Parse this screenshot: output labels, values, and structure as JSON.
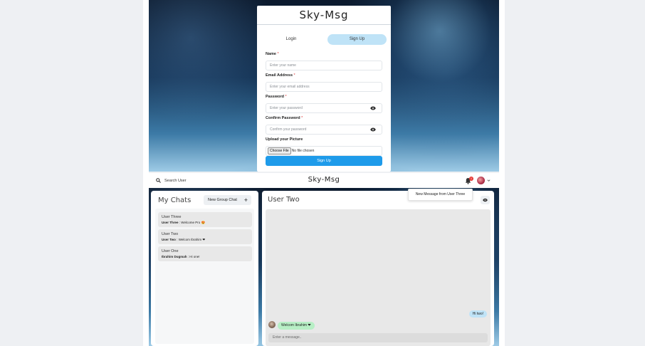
{
  "signup": {
    "title": "Sky-Msg",
    "tabs": {
      "login": "Login",
      "signup": "Sign Up"
    },
    "name": {
      "label": "Name",
      "required": "*",
      "placeholder": "Enter your name"
    },
    "email": {
      "label": "Email Address",
      "required": "*",
      "placeholder": "Enter your email address"
    },
    "password": {
      "label": "Password",
      "required": "*",
      "placeholder": "Enter your password"
    },
    "confirm": {
      "label": "Confirm Password",
      "required": "*",
      "placeholder": "Confirm your password"
    },
    "picture": {
      "label": "Upload your Picture",
      "choose_label": "Choose File",
      "no_file": "No file chosen"
    },
    "submit_label": "Sign Up"
  },
  "header": {
    "search_label": "Search User",
    "title": "Sky-Msg",
    "notification_count": "1"
  },
  "notification_popup": "New Message from User Three",
  "chats": {
    "title": "My Chats",
    "new_group_label": "New Group Chat",
    "items": [
      {
        "name": "User Three",
        "sender": "User Three",
        "message": "Welcome Pro 😍"
      },
      {
        "name": "User Two",
        "sender": "User Two",
        "message": "Welcom Ibrahim ❤"
      },
      {
        "name": "User One",
        "sender": "Ibrahim Dugmah",
        "message": "Hi one!"
      }
    ]
  },
  "conversation": {
    "title": "User Two",
    "messages": [
      {
        "side": "right",
        "text": "Hi two!"
      },
      {
        "side": "left",
        "text": "Welcom Ibrahim ❤"
      }
    ],
    "input_placeholder": "Enter a message.."
  },
  "colors": {
    "accent_blue": "#1e9bea",
    "tab_active": "#bfe3f7",
    "bubble_received": "#b7efc5",
    "badge_red": "#e53935"
  }
}
